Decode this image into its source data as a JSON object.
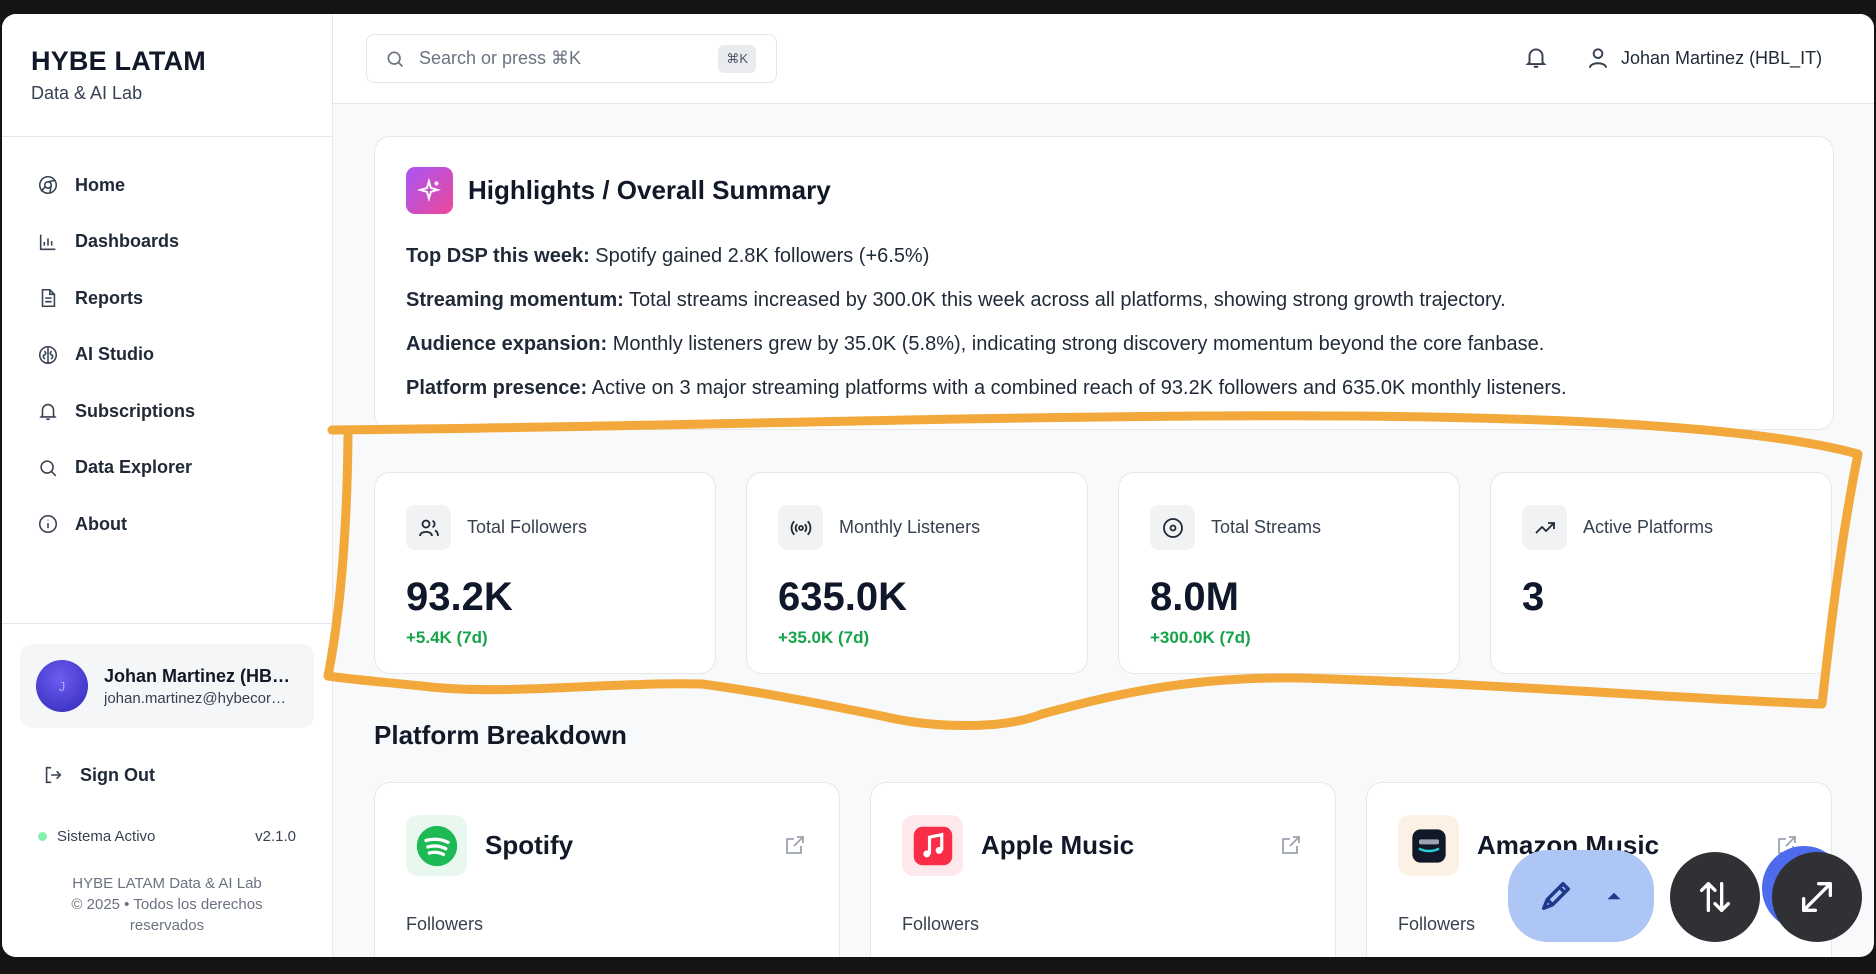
{
  "brand": {
    "title": "HYBE LATAM",
    "subtitle": "Data & AI Lab"
  },
  "nav": [
    {
      "label": "Home",
      "icon": "home-icon"
    },
    {
      "label": "Dashboards",
      "icon": "chart-icon"
    },
    {
      "label": "Reports",
      "icon": "document-icon"
    },
    {
      "label": "AI Studio",
      "icon": "brain-icon"
    },
    {
      "label": "Subscriptions",
      "icon": "bell-icon"
    },
    {
      "label": "Data Explorer",
      "icon": "search-icon"
    },
    {
      "label": "About",
      "icon": "info-icon"
    }
  ],
  "user": {
    "initial": "J",
    "name": "Johan Martinez (HBL_IT)",
    "email": "johan.martinez@hybecorp.com"
  },
  "signout": "Sign Out",
  "status": {
    "label": "Sistema Activo",
    "version": "v2.1.0",
    "color": "#86efac"
  },
  "footer": {
    "line1": "HYBE LATAM Data & AI Lab",
    "line2": "© 2025 • Todos los derechos reservados"
  },
  "search": {
    "placeholder": "Search or press ⌘K",
    "shortcut": "⌘K"
  },
  "topbar": {
    "user_label": "Johan Martinez (HBL_IT)"
  },
  "highlights": {
    "title": "Highlights / Overall Summary",
    "lines": [
      {
        "label": "Top DSP this week:",
        "text": " Spotify gained 2.8K followers (+6.5%)"
      },
      {
        "label": "Streaming momentum:",
        "text": " Total streams increased by 300.0K this week across all platforms, showing strong growth trajectory."
      },
      {
        "label": "Audience expansion:",
        "text": " Monthly listeners grew by 35.0K (5.8%), indicating strong discovery momentum beyond the core fanbase."
      },
      {
        "label": "Platform presence:",
        "text": " Active on 3 major streaming platforms with a combined reach of 93.2K followers and 635.0K monthly listeners."
      }
    ]
  },
  "stats": [
    {
      "label": "Total Followers",
      "value": "93.2K",
      "change": "+5.4K (7d)",
      "icon": "users-icon"
    },
    {
      "label": "Monthly Listeners",
      "value": "635.0K",
      "change": "+35.0K (7d)",
      "icon": "broadcast-icon"
    },
    {
      "label": "Total Streams",
      "value": "8.0M",
      "change": "+300.0K (7d)",
      "icon": "disc-icon"
    },
    {
      "label": "Active Platforms",
      "value": "3",
      "change": "",
      "icon": "trending-up-icon"
    }
  ],
  "platforms": {
    "title": "Platform Breakdown",
    "items": [
      {
        "name": "Spotify",
        "label": "Followers",
        "color": "#1db954"
      },
      {
        "name": "Apple Music",
        "label": "Followers",
        "color": "#fa2d48"
      },
      {
        "name": "Amazon Music",
        "label": "Followers",
        "color": "#111827"
      }
    ]
  },
  "colors": {
    "annotation": "#f2a83b",
    "positive": "#16a34a",
    "fab_light": "#aec6f6",
    "fab_dark": "#2f3134"
  }
}
